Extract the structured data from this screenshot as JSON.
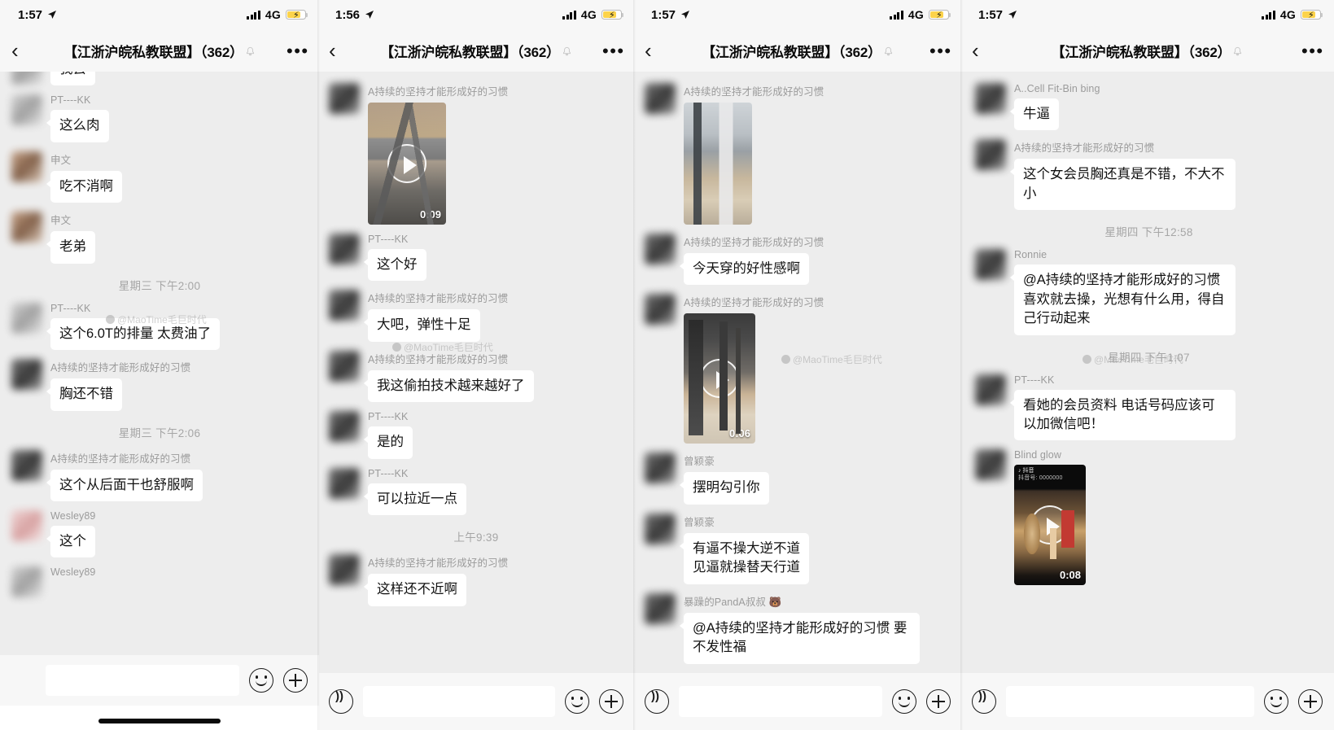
{
  "panels": [
    {
      "status": {
        "time": "1:57",
        "network": "4G"
      },
      "nav": {
        "back": "‹",
        "title": "【江浙沪皖私教联盟】（362）",
        "more": "•••"
      },
      "messages": [
        {
          "type": "text",
          "sender": "",
          "text": "我去",
          "avatar": "grey",
          "partial": true
        },
        {
          "type": "text",
          "sender": "PT----KK",
          "text": "这么肉",
          "avatar": "grey"
        },
        {
          "type": "text",
          "sender": "申文",
          "text": "吃不消啊",
          "avatar": "warm"
        },
        {
          "type": "text",
          "sender": "申文",
          "text": "老弟",
          "avatar": "warm"
        },
        {
          "type": "daystamp",
          "text": "星期三 下午2:00"
        },
        {
          "type": "text",
          "sender": "PT----KK",
          "text": "这个6.0T的排量 太费油了",
          "avatar": "grey"
        },
        {
          "type": "text",
          "sender": "A持续的坚持才能形成好的习惯",
          "text": "胸还不错",
          "avatar": "dark"
        },
        {
          "type": "daystamp",
          "text": "星期三 下午2:06"
        },
        {
          "type": "text",
          "sender": "A持续的坚持才能形成好的习惯",
          "text": "这个从后面干也舒服啊",
          "avatar": "dark"
        },
        {
          "type": "text",
          "sender": "Wesley89",
          "text": "这个",
          "avatar": "pink"
        },
        {
          "type": "sender-only",
          "sender": "Wesley89",
          "avatar": "grey"
        }
      ],
      "input": {
        "voice_icon": "voice-icon",
        "emoji_icon": "smiley-icon",
        "plus_icon": "plus-icon",
        "value": ""
      },
      "watermark": "@MaoTime毛巨时代"
    },
    {
      "status": {
        "time": "1:56",
        "network": "4G"
      },
      "nav": {
        "back": "‹",
        "title": "【江浙沪皖私教联盟】（362）",
        "more": "•••"
      },
      "messages": [
        {
          "type": "video",
          "sender": "A持续的坚持才能形成好的习惯",
          "duration": "0:09",
          "art": "art-gym1",
          "avatar": "dark"
        },
        {
          "type": "text",
          "sender": "PT----KK",
          "text": "这个好",
          "avatar": "dark"
        },
        {
          "type": "text",
          "sender": "A持续的坚持才能形成好的习惯",
          "text": "大吧，弹性十足",
          "avatar": "dark"
        },
        {
          "type": "text",
          "sender": "A持续的坚持才能形成好的习惯",
          "text": "我这偷拍技术越来越好了",
          "avatar": "dark"
        },
        {
          "type": "text",
          "sender": "PT----KK",
          "text": "是的",
          "avatar": "dark"
        },
        {
          "type": "text",
          "sender": "PT----KK",
          "text": "可以拉近一点",
          "avatar": "dark"
        },
        {
          "type": "daystamp",
          "text": "上午9:39"
        },
        {
          "type": "text",
          "sender": "A持续的坚持才能形成好的习惯",
          "text": "这样还不近啊",
          "avatar": "dark"
        }
      ],
      "input": {
        "voice_icon": "voice-icon",
        "emoji_icon": "smiley-icon",
        "plus_icon": "plus-icon",
        "value": ""
      },
      "watermark": "@MaoTime毛巨时代"
    },
    {
      "status": {
        "time": "1:57",
        "network": "4G"
      },
      "nav": {
        "back": "‹",
        "title": "【江浙沪皖私教联盟】（362）",
        "more": "•••"
      },
      "messages": [
        {
          "type": "image",
          "sender": "A持续的坚持才能形成好的习惯",
          "art": "art-gym3",
          "avatar": "dark"
        },
        {
          "type": "text",
          "sender": "A持续的坚持才能形成好的习惯",
          "text": "今天穿的好性感啊",
          "avatar": "dark"
        },
        {
          "type": "video",
          "sender": "A持续的坚持才能形成好的习惯",
          "duration": "0:06",
          "art": "art-gym2",
          "avatar": "dark"
        },
        {
          "type": "text",
          "sender": "曾颖豪",
          "text": "摆明勾引你",
          "avatar": "dark"
        },
        {
          "type": "text",
          "sender": "曾颖豪",
          "text": "有逼不操大逆不道\n见逼就操替天行道",
          "avatar": "dark"
        },
        {
          "type": "text",
          "sender": "暴躁的PandA叔叔 🐻",
          "text": "@A持续的坚持才能形成好的习惯 要不发性福",
          "avatar": "dark",
          "clipped": true
        }
      ],
      "input": {
        "voice_icon": "voice-icon",
        "emoji_icon": "smiley-icon",
        "plus_icon": "plus-icon",
        "value": ""
      },
      "watermark": "@MaoTime毛巨时代"
    },
    {
      "status": {
        "time": "1:57",
        "network": "4G"
      },
      "nav": {
        "back": "‹",
        "title": "【江浙沪皖私教联盟】（362）",
        "more": "•••"
      },
      "messages": [
        {
          "type": "text",
          "sender": "A..Cell Fit-Bin bing",
          "text": "牛逼",
          "avatar": "dark"
        },
        {
          "type": "text",
          "sender": "A持续的坚持才能形成好的习惯",
          "text": "这个女会员胸还真是不错，不大不小",
          "avatar": "dark"
        },
        {
          "type": "daystamp",
          "text": "星期四 下午12:58"
        },
        {
          "type": "text",
          "sender": "Ronnie",
          "text": "@A持续的坚持才能形成好的习惯 喜欢就去操，光想有什么用，得自己行动起来",
          "avatar": "dark"
        },
        {
          "type": "daystamp",
          "text": "星期四 下午1:07"
        },
        {
          "type": "text",
          "sender": "PT----KK",
          "text": "看她的会员资料 电话号码应该可以加微信吧！",
          "avatar": "dark"
        },
        {
          "type": "video",
          "sender": "Blind glow",
          "duration": "0:08",
          "art": "art-douyin",
          "avatar": "dark",
          "douyin": {
            "label": "抖音",
            "note": "抖音号: 0000000"
          }
        }
      ],
      "input": {
        "voice_icon": "voice-icon",
        "emoji_icon": "smiley-icon",
        "plus_icon": "plus-icon",
        "value": ""
      },
      "watermark": "@MaoTime毛巨时代"
    }
  ]
}
